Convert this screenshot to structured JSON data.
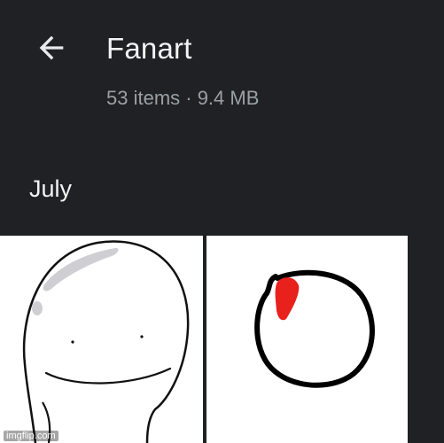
{
  "header": {
    "back_icon": "arrow-back-icon",
    "title": "Fanart",
    "subtitle": "53 items · 9.4 MB"
  },
  "section": {
    "label": "July"
  },
  "thumbnails": [
    {
      "name": "fanart-smiling-face"
    },
    {
      "name": "fanart-circle-red-mark"
    }
  ],
  "watermark": "imgflip.com",
  "colors": {
    "background": "#202124",
    "title_text": "#f1f3f4",
    "subtitle_text": "#9aa0a6",
    "drawing_red": "#e8211d"
  }
}
